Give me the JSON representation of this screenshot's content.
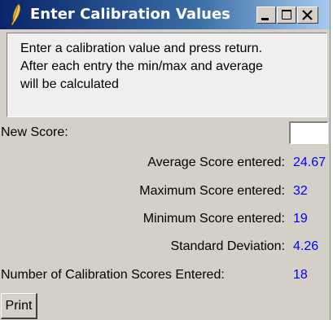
{
  "window": {
    "title": "Enter Calibration Values",
    "title_icon": "feather-icon",
    "controls": {
      "minimize": "minimize-icon",
      "maximize": "maximize-icon",
      "close": "close-icon"
    }
  },
  "description": {
    "line1": "Enter a calibration value and press return.",
    "line2": "After each entry the min/max and average",
    "line3": "will be calculated"
  },
  "form": {
    "new_score_label": "New Score:",
    "new_score_value": ""
  },
  "stats": {
    "average_label": "Average Score entered:",
    "average_value": "24.67",
    "maximum_label": "Maximum Score entered:",
    "maximum_value": "32",
    "minimum_label": "Minimum Score entered:",
    "minimum_value": "19",
    "stddev_label": "Standard Deviation:",
    "stddev_value": "4.26",
    "count_label": "Number of Calibration Scores Entered:",
    "count_value": "18"
  },
  "actions": {
    "print_label": "Print"
  },
  "colors": {
    "value_text": "#0000ff",
    "titlebar": "#0a246a",
    "window_bg": "#d4d0c8"
  }
}
